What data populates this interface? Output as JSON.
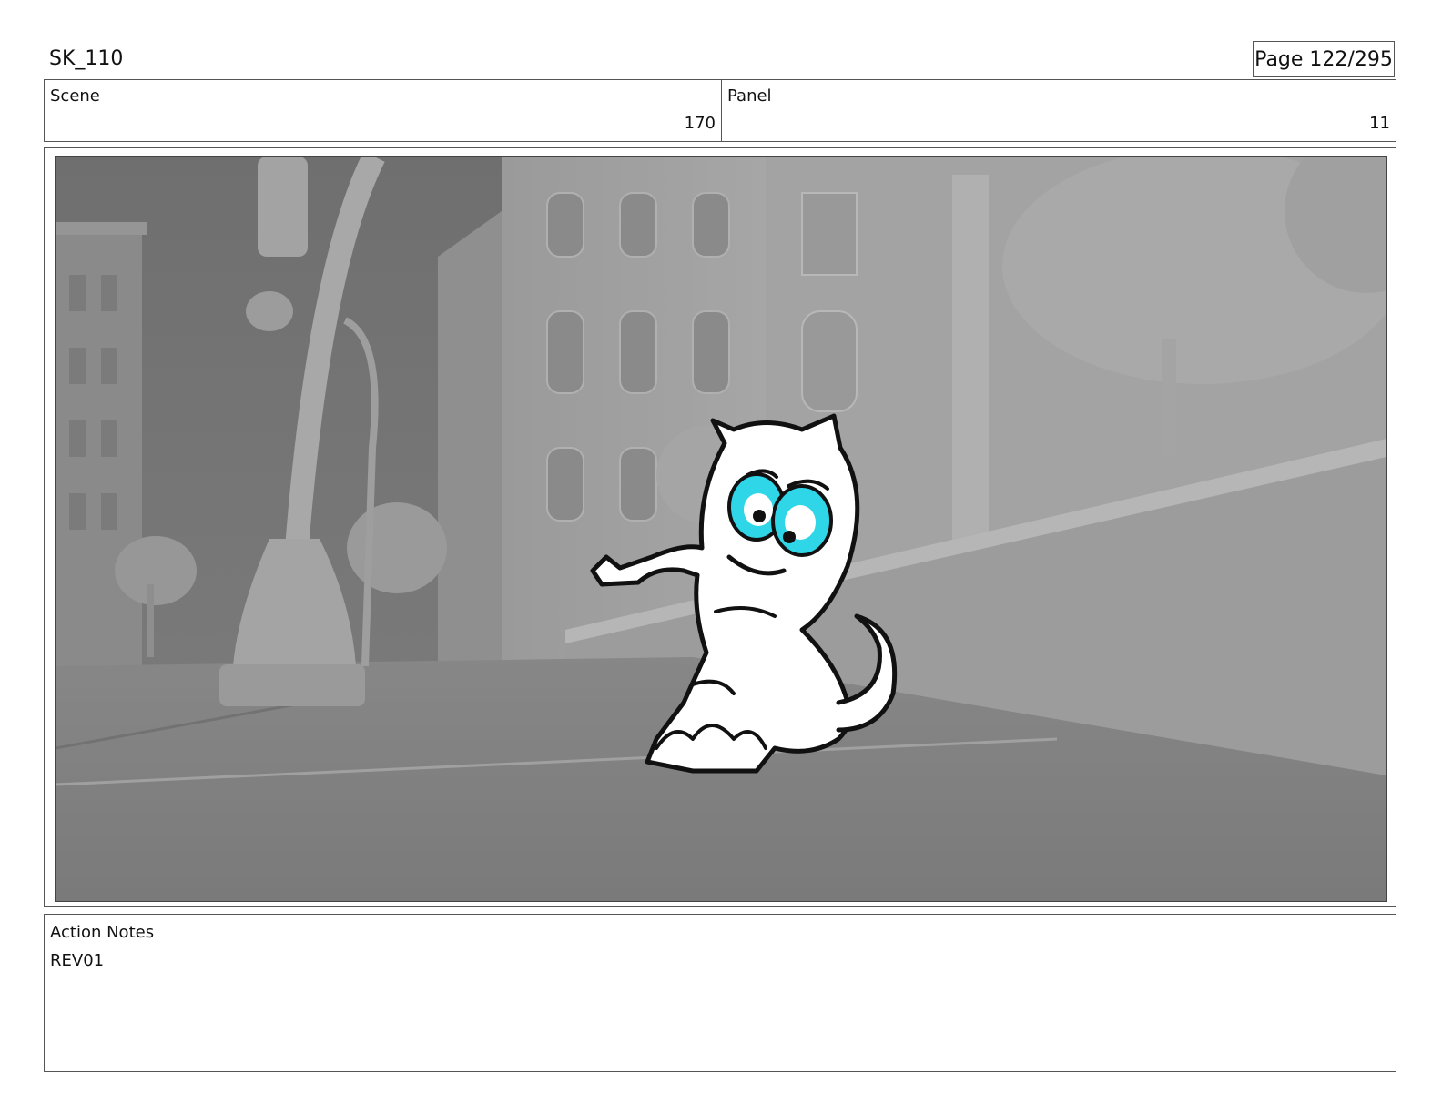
{
  "header": {
    "sequence": "SK_110",
    "page": "Page 122/295"
  },
  "info": {
    "scene_label": "Scene",
    "scene_value": "170",
    "panel_label": "Panel",
    "panel_value": "11"
  },
  "notes": {
    "label": "Action Notes",
    "text": "REV01"
  },
  "colors": {
    "sketch_accent": "#2fd6e8",
    "background_gray": "#8c8c8c"
  }
}
